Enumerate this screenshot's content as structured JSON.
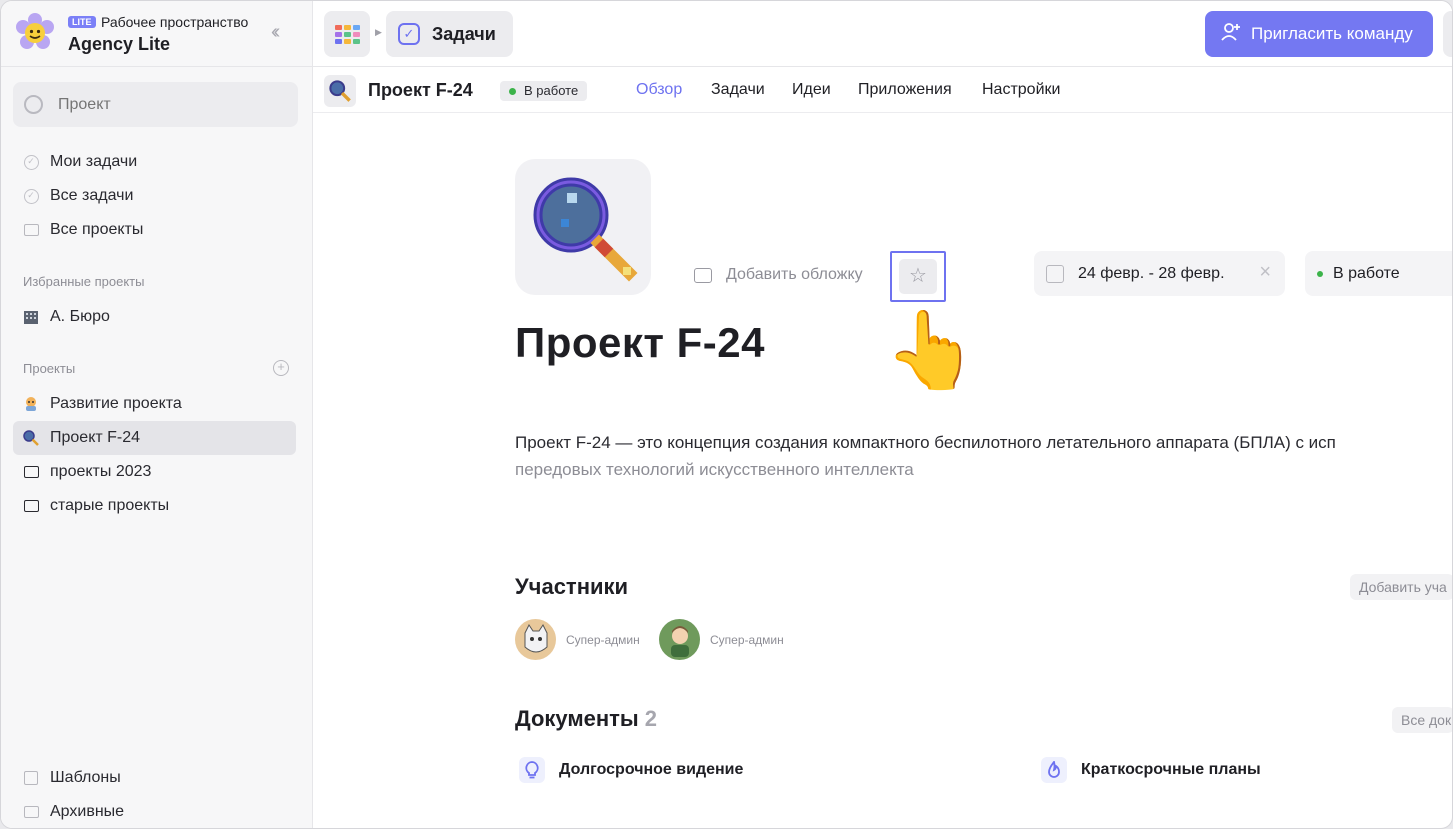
{
  "workspace": {
    "badge": "LITE",
    "caption": "Рабочее пространство",
    "name": "Agency Lite"
  },
  "sidebar": {
    "search_placeholder": "Проект",
    "nav": [
      {
        "label": "Мои задачи",
        "icon": "check-circle-icon"
      },
      {
        "label": "Все задачи",
        "icon": "check-circle-icon"
      },
      {
        "label": "Все проекты",
        "icon": "folder-icon"
      }
    ],
    "favorites_label": "Избранные проекты",
    "favorites": [
      {
        "label": "А. Бюро",
        "icon": "building-icon"
      }
    ],
    "projects_label": "Проекты",
    "projects": [
      {
        "label": "Развитие проекта",
        "icon": "rocket-avatar-icon"
      },
      {
        "label": "Проект F-24",
        "icon": "magnifier-icon",
        "active": true
      },
      {
        "label": "проекты 2023",
        "icon": "folder-icon"
      },
      {
        "label": "старые проекты",
        "icon": "folder-icon"
      }
    ],
    "bottom": [
      {
        "label": "Шаблоны",
        "icon": "templates-icon"
      },
      {
        "label": "Архивные",
        "icon": "archive-icon"
      }
    ]
  },
  "topbar": {
    "breadcrumb": "Задачи",
    "invite_label": "Пригласить команду"
  },
  "project_bar": {
    "title": "Проект F-24",
    "status": "В работе",
    "tabs": [
      "Обзор",
      "Задачи",
      "Идеи",
      "Приложения",
      "Настройки"
    ],
    "active_tab": "Обзор"
  },
  "overview": {
    "add_cover": "Добавить обложку",
    "date_range": "24 февр. - 28 февр.",
    "status": "В работе",
    "title": "Проект F-24",
    "description_1": "Проект F-24 — это концепция создания компактного беспилотного летательного аппарата (БПЛА) с исп",
    "description_2": "передовых технологий искусственного интеллекта"
  },
  "members": {
    "title": "Участники",
    "add_label": "Добавить уча",
    "list": [
      {
        "role": "Супер-админ"
      },
      {
        "role": "Супер-админ"
      }
    ]
  },
  "documents": {
    "title": "Документы",
    "count": "2",
    "all_label": "Все док",
    "list": [
      {
        "title": "Долгосрочное видение",
        "icon": "lightbulb-icon"
      },
      {
        "title": "Краткосрочные планы",
        "icon": "flame-icon"
      }
    ]
  },
  "colors": {
    "accent": "#7478f2",
    "status_green": "#3cb34a"
  }
}
